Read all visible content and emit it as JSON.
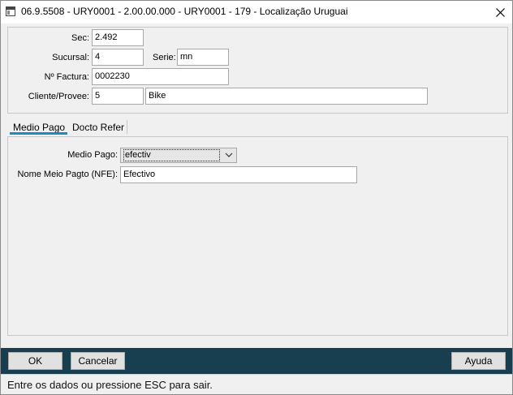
{
  "window": {
    "title": "06.9.5508 - URY0001 - 2.00.00.000 - URY0001 - 179 - Localização Uruguai"
  },
  "header": {
    "sec": {
      "label": "Sec:",
      "value": "2.492"
    },
    "sucursal": {
      "label": "Sucursal:",
      "value": "4"
    },
    "serie": {
      "label": "Serie:",
      "value": "mn"
    },
    "factura": {
      "label": "Nº Factura:",
      "value": "0002230"
    },
    "cliente": {
      "label": "Cliente/Provee:",
      "code": "5",
      "name": "Bike"
    }
  },
  "tabs": [
    {
      "label": "Medio Pago",
      "active": true
    },
    {
      "label": "Docto Refer",
      "active": false
    }
  ],
  "medio_pago": {
    "medio_label": "Medio Pago:",
    "medio_value": "efectiv",
    "nome_label": "Nome Meio Pagto (NFE):",
    "nome_value": "Efectivo"
  },
  "buttons": {
    "ok": "OK",
    "cancelar": "Cancelar",
    "ayuda": "Ayuda"
  },
  "status": {
    "text": "Entre os dados ou pressione ESC para sair."
  },
  "colors": {
    "footer_bar": "#173f50",
    "tab_accent": "#1a8bc9"
  }
}
